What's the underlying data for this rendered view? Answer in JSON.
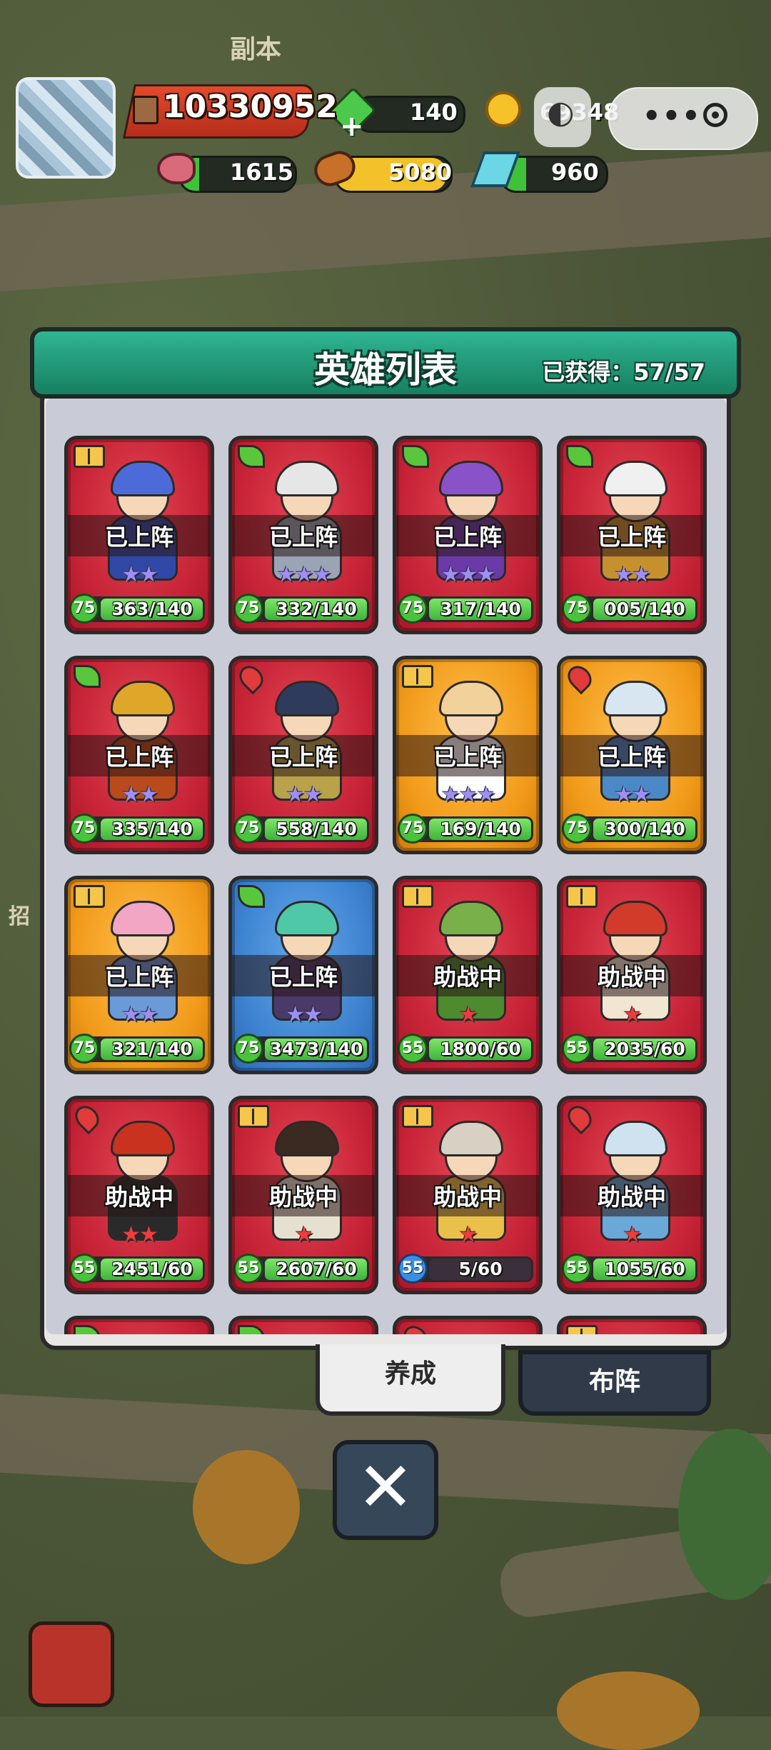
{
  "map": {
    "top_label": "副本",
    "side_label": "招"
  },
  "resources": {
    "power": "10330952",
    "gems": "140",
    "gold": "69348",
    "meat": "1615",
    "wood": "5080",
    "crystal": "960"
  },
  "panel": {
    "title": "英雄列表",
    "obtained": "已获得：57/57"
  },
  "heroes": [
    {
      "status": "已上阵",
      "level": "75",
      "xp": "363/140",
      "stars": "★★",
      "star_color": "purple",
      "card": "red",
      "type": "book",
      "head": "#4d6bd8",
      "body": "#3149a6"
    },
    {
      "status": "已上阵",
      "level": "75",
      "xp": "332/140",
      "stars": "★★★",
      "star_color": "purple",
      "card": "red",
      "type": "leaf",
      "head": "#e6e6e6",
      "body": "#9aa4b4"
    },
    {
      "status": "已上阵",
      "level": "75",
      "xp": "317/140",
      "stars": "★★★",
      "star_color": "purple",
      "card": "red",
      "type": "leaf",
      "head": "#8a52c9",
      "body": "#6b3aa8"
    },
    {
      "status": "已上阵",
      "level": "75",
      "xp": "005/140",
      "stars": "★★",
      "star_color": "purple",
      "card": "red",
      "type": "leaf",
      "head": "#f0f0f0",
      "body": "#c7902f"
    },
    {
      "status": "已上阵",
      "level": "75",
      "xp": "335/140",
      "stars": "★★",
      "star_color": "purple",
      "card": "red",
      "type": "leaf",
      "head": "#e0a62a",
      "body": "#b84a1c"
    },
    {
      "status": "已上阵",
      "level": "75",
      "xp": "558/140",
      "stars": "★★",
      "star_color": "purple",
      "card": "red",
      "type": "blood",
      "head": "#2f3b5c",
      "body": "#b8a24a"
    },
    {
      "status": "已上阵",
      "level": "75",
      "xp": "169/140",
      "stars": "★★★",
      "star_color": "purple",
      "card": "gold",
      "type": "book",
      "head": "#f2d29a",
      "body": "#ffffff"
    },
    {
      "status": "已上阵",
      "level": "75",
      "xp": "300/140",
      "stars": "★★",
      "star_color": "purple",
      "card": "gold",
      "type": "blood",
      "head": "#d8e6f2",
      "body": "#4a88c8"
    },
    {
      "status": "已上阵",
      "level": "75",
      "xp": "321/140",
      "stars": "★★",
      "star_color": "purple",
      "card": "gold",
      "type": "book",
      "head": "#f2a6c4",
      "body": "#6a9ad8"
    },
    {
      "status": "已上阵",
      "level": "75",
      "xp": "3473/140",
      "stars": "★★",
      "star_color": "purple",
      "card": "blue",
      "type": "leaf",
      "head": "#4ec8a6",
      "body": "#4a3a6a"
    },
    {
      "status": "助战中",
      "level": "55",
      "xp": "1800/60",
      "stars": "★",
      "star_color": "red",
      "card": "red",
      "type": "book",
      "head": "#7ab04a",
      "body": "#4e8a2e"
    },
    {
      "status": "助战中",
      "level": "55",
      "xp": "2035/60",
      "stars": "★",
      "star_color": "red",
      "card": "red",
      "type": "book",
      "head": "#d23a2a",
      "body": "#f0e6d2"
    },
    {
      "status": "助战中",
      "level": "55",
      "xp": "2451/60",
      "stars": "★★",
      "star_color": "red",
      "card": "red",
      "type": "blood",
      "head": "#c8321e",
      "body": "#2a2a2a"
    },
    {
      "status": "助战中",
      "level": "55",
      "xp": "2607/60",
      "stars": "★",
      "star_color": "red",
      "card": "red",
      "type": "book",
      "head": "#3a2a22",
      "body": "#e6e0d0"
    },
    {
      "status": "助战中",
      "level": "55",
      "xp": "5/60",
      "stars": "★",
      "star_color": "red",
      "card": "red",
      "type": "book",
      "head": "#d8d0c2",
      "body": "#e8c04a",
      "badge": "blue",
      "dark": true
    },
    {
      "status": "助战中",
      "level": "55",
      "xp": "1055/60",
      "stars": "★",
      "star_color": "red",
      "card": "red",
      "type": "blood",
      "head": "#cfe2f0",
      "body": "#6aa8d8"
    },
    {
      "status": "",
      "level": "",
      "xp": "",
      "stars": "",
      "star_color": "red",
      "card": "red",
      "type": "leaf",
      "head": "#c83a3a",
      "body": "#c83a3a"
    },
    {
      "status": "",
      "level": "",
      "xp": "",
      "stars": "",
      "star_color": "red",
      "card": "red",
      "type": "leaf",
      "head": "#c83a3a",
      "body": "#c83a3a"
    },
    {
      "status": "",
      "level": "",
      "xp": "",
      "stars": "",
      "star_color": "red",
      "card": "red",
      "type": "blood",
      "head": "#c83a3a",
      "body": "#c83a3a"
    },
    {
      "status": "",
      "level": "",
      "xp": "",
      "stars": "",
      "star_color": "red",
      "card": "red",
      "type": "book",
      "head": "#c83a3a",
      "body": "#c83a3a"
    }
  ],
  "tabs": {
    "active": "养成",
    "inactive": "布阵"
  },
  "close_label": "✕"
}
